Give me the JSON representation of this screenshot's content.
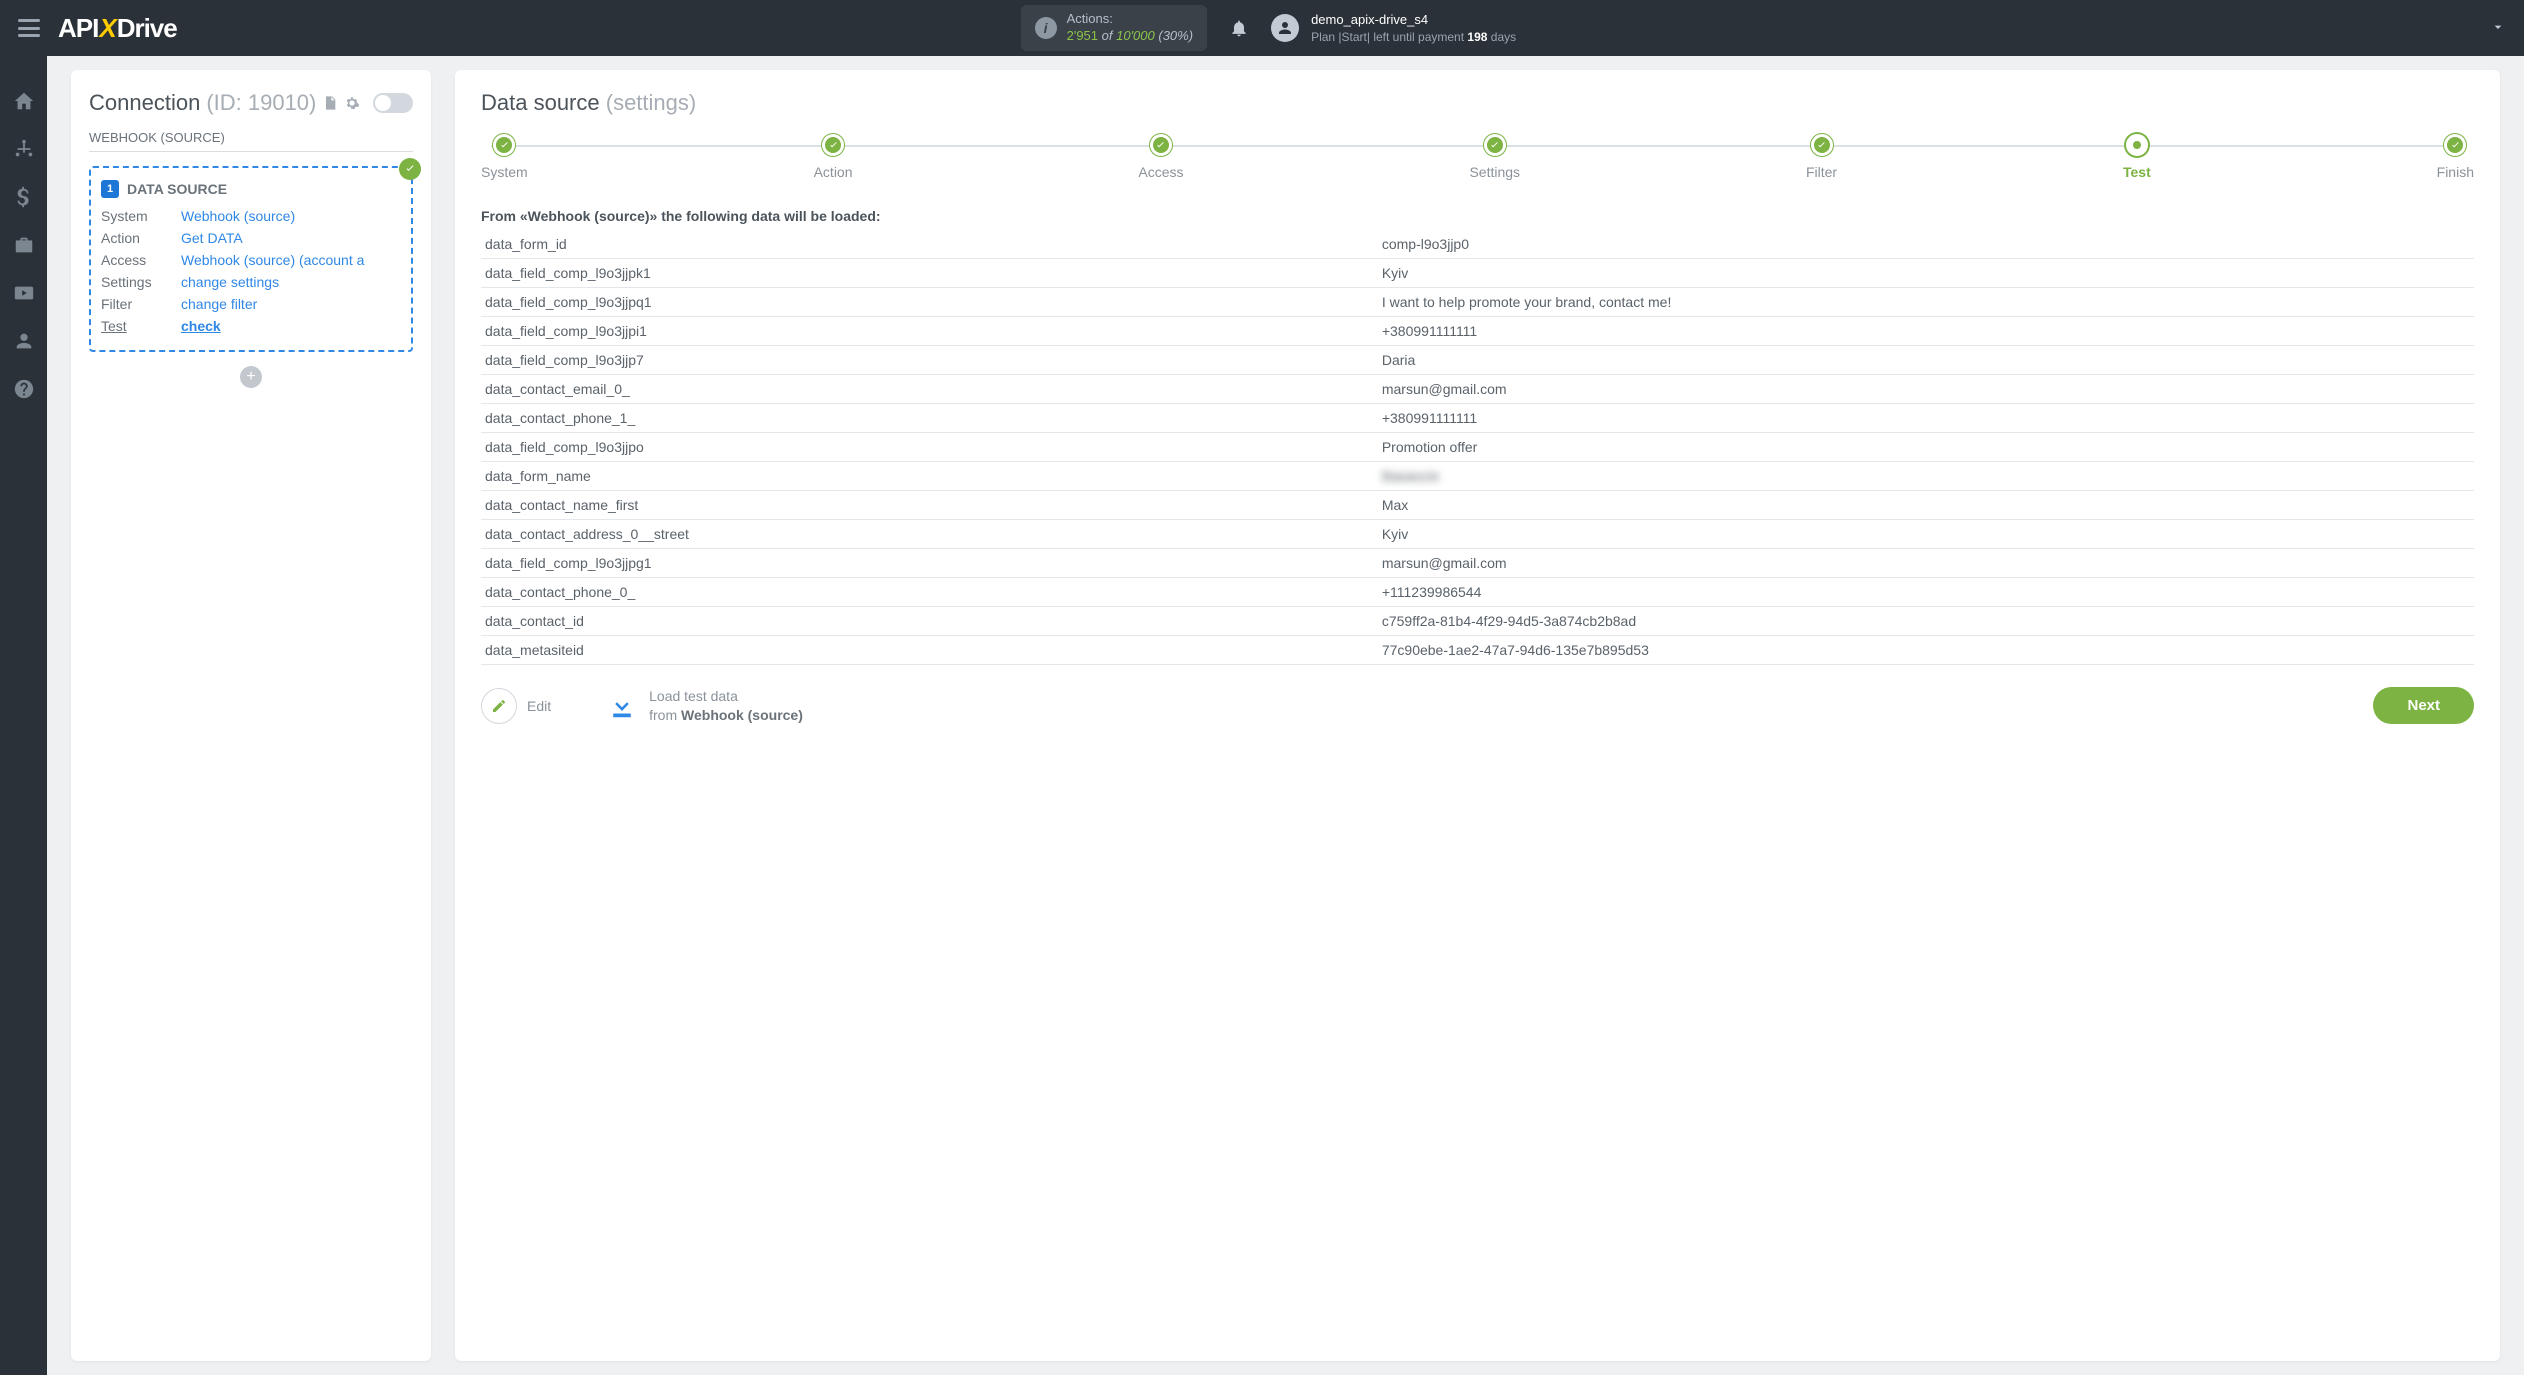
{
  "header": {
    "logo_pre": "API",
    "logo_x": "X",
    "logo_post": "Drive",
    "actions_label": "Actions:",
    "actions_used": "2'951",
    "actions_of": "of",
    "actions_total": "10'000",
    "actions_pct": "(30%)",
    "username": "demo_apix-drive_s4",
    "plan_prefix": "Plan |Start| left until payment",
    "plan_days": "198",
    "plan_suffix": "days"
  },
  "left": {
    "title": "Connection",
    "title_id": "(ID: 19010)",
    "wh_label": "WEBHOOK (SOURCE)",
    "ds_badge": "1",
    "ds_title": "DATA SOURCE",
    "rows": {
      "system_k": "System",
      "system_v": "Webhook (source)",
      "action_k": "Action",
      "action_v": "Get DATA",
      "access_k": "Access",
      "access_v": "Webhook (source) (account a",
      "settings_k": "Settings",
      "settings_v": "change settings",
      "filter_k": "Filter",
      "filter_v": "change filter",
      "test_k": "Test",
      "test_v": "check"
    }
  },
  "right": {
    "title": "Data source",
    "title_sub": "(settings)",
    "steps": [
      {
        "label": "System"
      },
      {
        "label": "Action"
      },
      {
        "label": "Access"
      },
      {
        "label": "Settings"
      },
      {
        "label": "Filter"
      },
      {
        "label": "Test",
        "current": true
      },
      {
        "label": "Finish"
      }
    ],
    "table_title": "From «Webhook (source)» the following data will be loaded:",
    "rows": [
      {
        "k": "data_form_id",
        "v": "comp-l9o3jjp0"
      },
      {
        "k": "data_field_comp_l9o3jjpk1",
        "v": "Kyiv"
      },
      {
        "k": "data_field_comp_l9o3jjpq1",
        "v": "I want to help promote your brand, contact me!"
      },
      {
        "k": "data_field_comp_l9o3jjpi1",
        "v": "+380991111111"
      },
      {
        "k": "data_field_comp_l9o3jjp7",
        "v": "Daria"
      },
      {
        "k": "data_contact_email_0_",
        "v": "marsun@gmail.com"
      },
      {
        "k": "data_contact_phone_1_",
        "v": "+380991111111"
      },
      {
        "k": "data_field_comp_l9o3jjpo",
        "v": "Promotion offer"
      },
      {
        "k": "data_form_name",
        "v": "Вакансія",
        "blur": true
      },
      {
        "k": "data_contact_name_first",
        "v": "Max"
      },
      {
        "k": "data_contact_address_0__street",
        "v": "Kyiv"
      },
      {
        "k": "data_field_comp_l9o3jjpg1",
        "v": "marsun@gmail.com"
      },
      {
        "k": "data_contact_phone_0_",
        "v": "+111239986544"
      },
      {
        "k": "data_contact_id",
        "v": "c759ff2a-81b4-4f29-94d5-3a874cb2b8ad"
      },
      {
        "k": "data_metasiteid",
        "v": "77c90ebe-1ae2-47a7-94d6-135e7b895d53"
      }
    ],
    "edit_label": "Edit",
    "load_line1": "Load test data",
    "load_line2_pre": "from ",
    "load_line2_bold": "Webhook (source)",
    "next_label": "Next"
  }
}
